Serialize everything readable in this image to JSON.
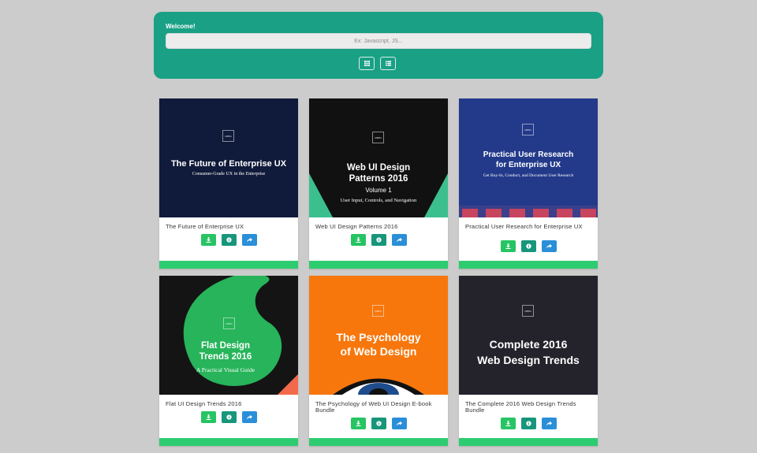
{
  "header": {
    "welcome": "Welcome!",
    "search_placeholder": "Ex: Javascript, JS...",
    "view_buttons": [
      {
        "icon": "grid-icon"
      },
      {
        "icon": "list-icon"
      }
    ]
  },
  "cards": [
    {
      "title": "The Future of Enterprise UX",
      "cover": {
        "bg": "#101a3a",
        "logo": "UXPin",
        "title_lines": [
          "The Future of Enterprise UX"
        ],
        "subtitle": "Consumer-Grade UX in the Enterprise"
      }
    },
    {
      "title": "Web UI Design Patterns 2016",
      "cover": {
        "bg": "#111111",
        "logo": "UXPin",
        "title_lines": [
          "Web UI Design",
          "Patterns 2016"
        ],
        "volume": "Volume 1",
        "subtitle": "User Input, Controls, and Navigation"
      }
    },
    {
      "title": "Practical User Research for Enterprise UX",
      "cover": {
        "bg": "#233a8a",
        "logo": "UXPin",
        "title_lines": [
          "Practical User Research",
          "for Enterprise UX"
        ],
        "subtitle": "Get Buy-In, Conduct, and Document User Research"
      }
    },
    {
      "title": "Flat UI Design Trends 2016",
      "cover": {
        "bg": "#141414",
        "logo": "UXPin",
        "title_lines": [
          "Flat Design",
          "Trends 2016"
        ],
        "subtitle": "A Practical Visual Guide"
      }
    },
    {
      "title": "The Psychology of Web UI Design E-book Bundle",
      "cover": {
        "bg": "#f7770d",
        "logo": "UXPin",
        "title_lines": [
          "The Psychology",
          "of Web Design"
        ]
      }
    },
    {
      "title": "The Complete 2016 Web Design Trends Bundle",
      "cover": {
        "bg": "#24222b",
        "logo": "UXPin",
        "title_lines": [
          "Complete 2016",
          "Web Design Trends"
        ]
      }
    }
  ],
  "actions": {
    "download_icon": "download-icon",
    "info_icon": "info-icon",
    "share_icon": "share-icon"
  },
  "colors": {
    "header": "#1aa085",
    "download": "#27c463",
    "info": "#17967b",
    "share": "#2a8fd8",
    "footer": "#2ecc71"
  }
}
